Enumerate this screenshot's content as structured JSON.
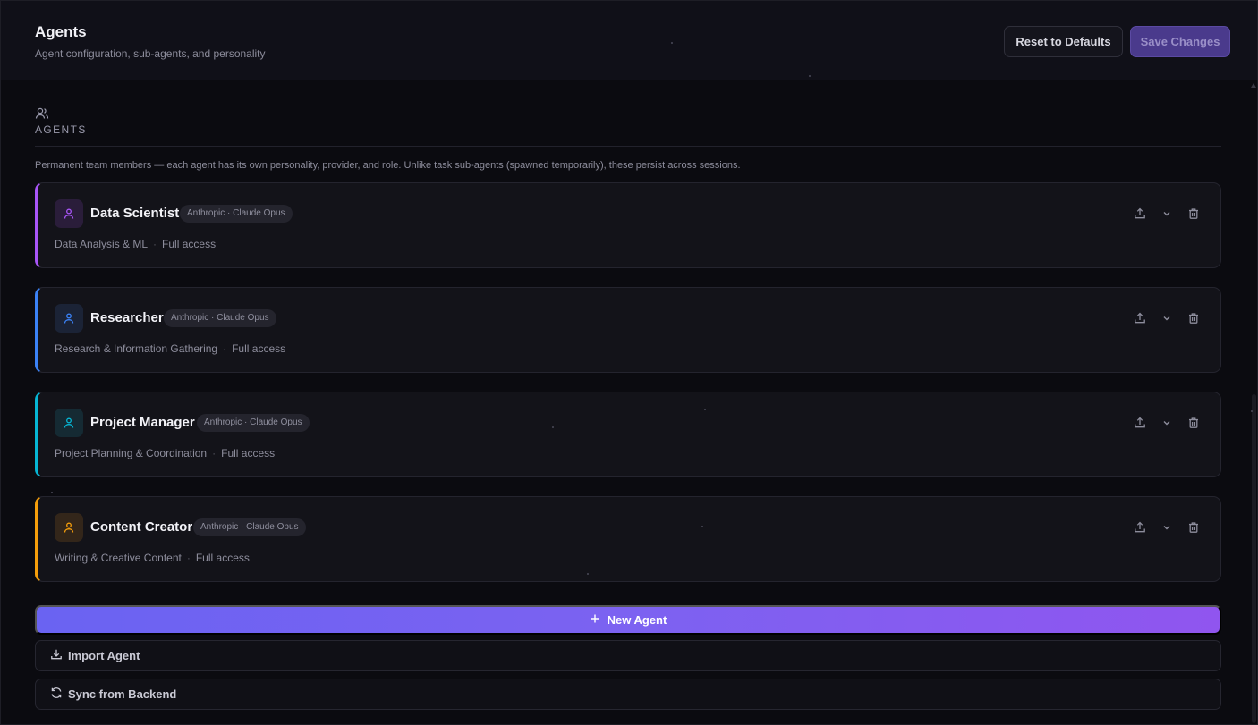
{
  "header": {
    "title": "Agents",
    "subtitle": "Agent configuration, sub-agents, and personality",
    "reset_label": "Reset to Defaults",
    "save_label": "Save Changes"
  },
  "section": {
    "label": "AGENTS",
    "icon": "users-icon",
    "description": "Permanent team members — each agent has its own personality, provider, and role. Unlike task sub-agents (spawned temporarily), these persist across sessions."
  },
  "agents": [
    {
      "name": "Data Scientist",
      "badge": "Anthropic · Claude Opus",
      "role": "Data Analysis & ML",
      "access": "Full access",
      "accent": "#a855f7",
      "avatar_bg": "#2a1d3a",
      "icon": "user-icon"
    },
    {
      "name": "Researcher",
      "badge": "Anthropic · Claude Opus",
      "role": "Research & Information Gathering",
      "access": "Full access",
      "accent": "#3b82f6",
      "avatar_bg": "#1b2336",
      "icon": "user-icon"
    },
    {
      "name": "Project Manager",
      "badge": "Anthropic · Claude Opus",
      "role": "Project Planning & Coordination",
      "access": "Full access",
      "accent": "#06b6d4",
      "avatar_bg": "#152a33",
      "icon": "user-icon"
    },
    {
      "name": "Content Creator",
      "badge": "Anthropic · Claude Opus",
      "role": "Writing & Creative Content",
      "access": "Full access",
      "accent": "#f59e0b",
      "avatar_bg": "#33261a",
      "icon": "user-icon"
    }
  ],
  "footer": {
    "new_agent_label": "New Agent",
    "import_label": "Import Agent",
    "sync_label": "Sync from Backend"
  },
  "colors": {
    "background": "#0b0b10",
    "primary_gradient_start": "#6a63f2",
    "primary_gradient_end": "#9055ef"
  }
}
